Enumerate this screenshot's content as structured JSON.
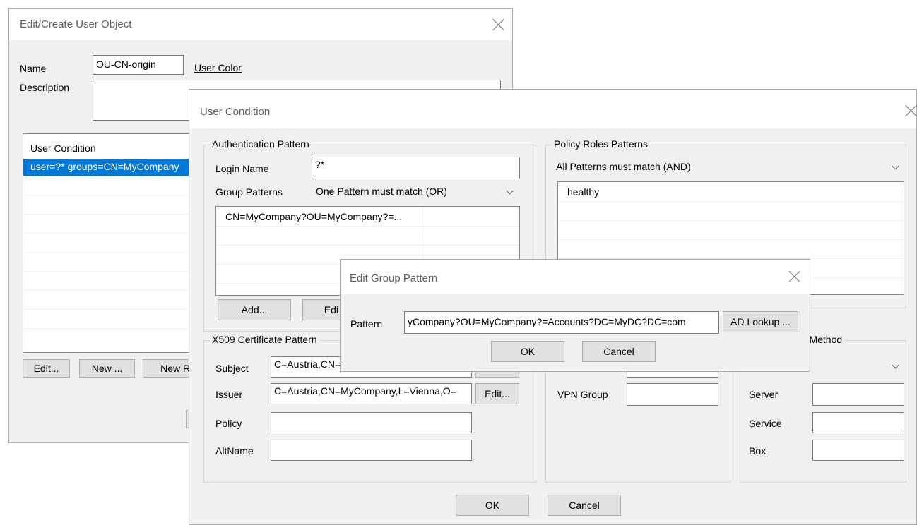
{
  "user_object": {
    "title": "Edit/Create User Object",
    "name_label": "Name",
    "name_value": "OU-CN-origin",
    "user_color_link": "User Color",
    "description_label": "Description",
    "description_value": "",
    "conditions_header": "User Condition",
    "conditions_selected_row": "user=?* groups=CN=MyCompany",
    "edit_button": "Edit...",
    "new_button": "New ...",
    "new_re_button": "New Re"
  },
  "user_condition": {
    "title": "User Condition",
    "auth_group_title": "Authentication Pattern",
    "login_name_label": "Login Name",
    "login_name_value": "?*",
    "group_patterns_label": "Group Patterns",
    "group_patterns_mode": "One Pattern must match (OR)",
    "group_patterns_items": [
      "CN=MyCompany?OU=MyCompany?=..."
    ],
    "add_button": "Add...",
    "edit_button": "Edi",
    "x509_group_title": "X509 Certificate Pattern",
    "subject_label": "Subject",
    "subject_value": "C=Austria,CN=",
    "issuer_label": "Issuer",
    "issuer_value": "C=Austria,CN=MyCompany,L=Vienna,O=",
    "issuer_edit_button": "Edit...",
    "policy_label": "Policy",
    "policy_value": "",
    "altname_label": "AltName",
    "altname_value": "",
    "policy_roles_title": "Policy Roles Patterns",
    "policy_roles_mode": "All Patterns must match (AND)",
    "policy_roles_items": [
      "healthy"
    ],
    "vpn_group_label": "VPN Group",
    "vpn_group_value": "",
    "auth_method_title": "on Method",
    "server_label": "Server",
    "service_label": "Service",
    "box_label": "Box",
    "ok_button": "OK",
    "cancel_button": "Cancel"
  },
  "group_pattern": {
    "title": "Edit Group Pattern",
    "pattern_label": "Pattern",
    "pattern_value": "yCompany?OU=MyCompany?=Accounts?DC=MyDC?DC=com",
    "ad_lookup_button": "AD Lookup ...",
    "ok_button": "OK",
    "cancel_button": "Cancel"
  },
  "colors": {
    "selection": "#0078d7",
    "dialog_bg": "#f0f0f0",
    "title_bg": "#ffffff"
  }
}
